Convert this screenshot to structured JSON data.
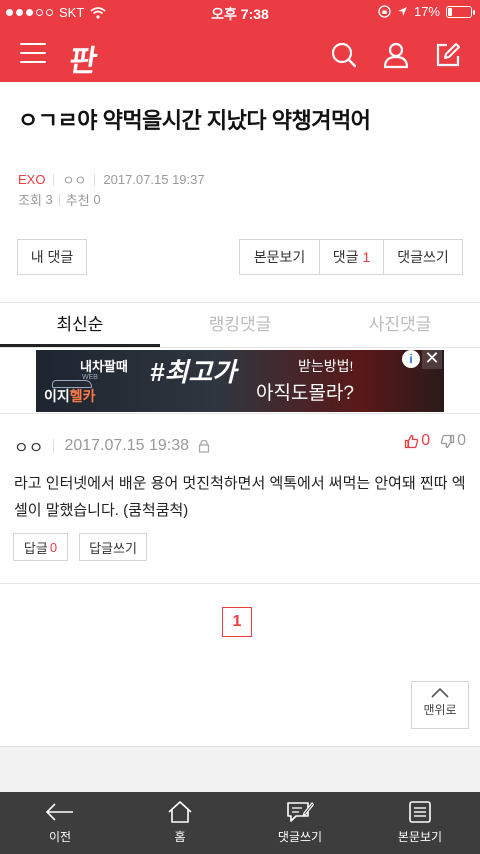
{
  "status": {
    "carrier": "SKT",
    "time": "오후 7:38",
    "battery_text": "17%",
    "battery_level": 0.17
  },
  "header": {
    "logo": "판",
    "icons": [
      "menu-icon",
      "search-icon",
      "user-icon",
      "write-icon"
    ],
    "brand_color": "#eb3b43"
  },
  "post": {
    "title": "ㅇㄱㄹ야 약먹을시간 지났다 약챙겨먹어",
    "category": "EXO",
    "author": "ㅇㅇ",
    "date": "2017.07.15 19:37",
    "views_label": "조회",
    "views": "3",
    "likes_label": "추천",
    "likes": "0"
  },
  "actions": {
    "my_comments": "내 댓글",
    "view_body": "본문보기",
    "comments": "댓글",
    "comments_count": "1",
    "write_comment": "댓글쓰기"
  },
  "tabs": [
    {
      "label": "최신순",
      "active": true
    },
    {
      "label": "랭킹댓글",
      "active": false
    },
    {
      "label": "사진댓글",
      "active": false
    }
  ],
  "ad": {
    "line1": "내차팔때",
    "headline": "#최고가",
    "line3": "받는방법!",
    "line4": "아직도몰라?",
    "brand_a": "이지",
    "brand_b": "헬카",
    "brand_small": "WEB"
  },
  "comment": {
    "author": "ㅇㅇ",
    "date": "2017.07.15 19:38",
    "up": "0",
    "down": "0",
    "body": "라고 인터넷에서 배운 용어 멋진척하면서 엑톡에서 써먹는 안여돼 찐따 엑셀이 말했습니다. (쿰척쿰척)",
    "reply_label": "답글",
    "reply_count": "0",
    "write_reply": "답글쓰기"
  },
  "pagination": {
    "current": "1"
  },
  "to_top": "맨위로",
  "bottom_nav": [
    {
      "label": "이전",
      "icon": "back-arrow-icon"
    },
    {
      "label": "홈",
      "icon": "home-icon"
    },
    {
      "label": "댓글쓰기",
      "icon": "comment-write-icon"
    },
    {
      "label": "본문보기",
      "icon": "document-icon"
    }
  ]
}
